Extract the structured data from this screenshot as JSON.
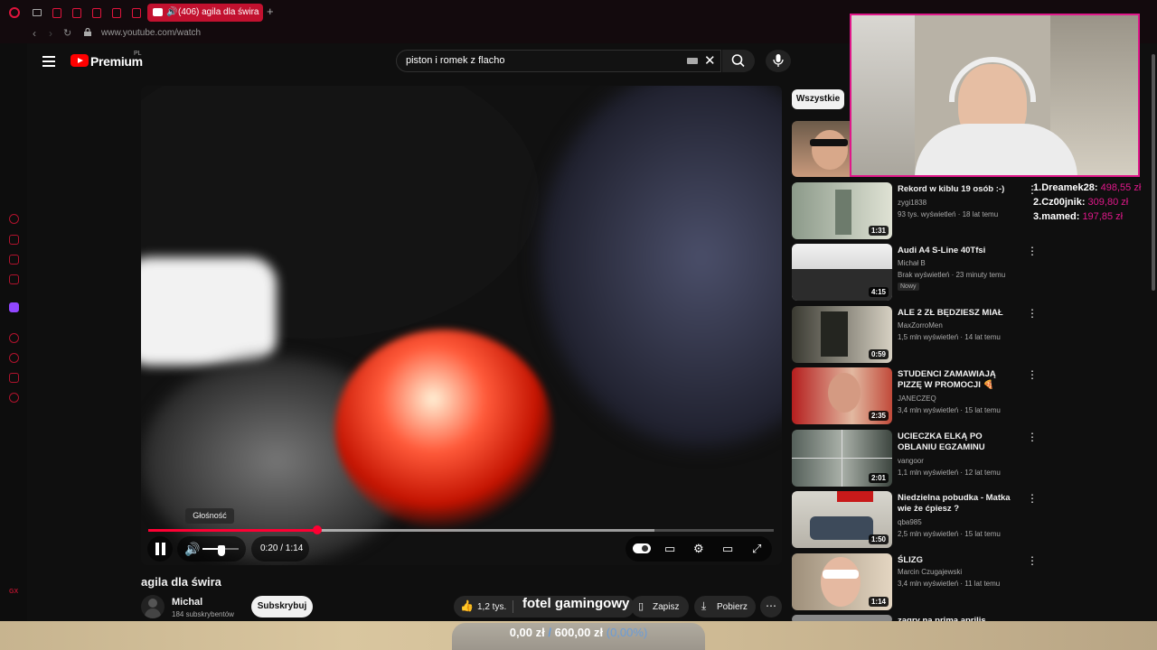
{
  "browser": {
    "tab_title": "(406) agila dla świra -",
    "url": "www.youtube.com/watch"
  },
  "youtube": {
    "brand": "Premium",
    "region": "PL",
    "search_query": "piston i romek z flacho"
  },
  "player": {
    "tooltip": "Głośność",
    "time": "0:20 / 1:14",
    "progress_fraction": 0.27,
    "volume_fraction": 0.5
  },
  "video": {
    "title": "agila dla świra",
    "channel": "Michal",
    "subscribers": "184 subskrybentów",
    "subscribe_label": "Subskrybuj",
    "likes": "1,2 tys.",
    "save_label": "Zapisz",
    "download_label": "Pobierz"
  },
  "filter_chip": "Wszystkie",
  "recommendations": [
    {
      "title": "Rekord w kiblu 19 osób :-)",
      "channel": "zygi1838",
      "meta": "93 tys. wyświetleń · 18 lat temu",
      "duration": "1:31"
    },
    {
      "title": "Audi A4 S-Line 40Tfsi",
      "channel": "Michał B",
      "meta": "Brak wyświetleń · 23 minuty temu",
      "badge": "Nowy",
      "duration": "4:15"
    },
    {
      "title": "ALE 2 ZŁ BĘDZIESZ MIAŁ",
      "channel": "MaxZorroMen",
      "meta": "1,5 mln wyświetleń · 14 lat temu",
      "duration": "0:59"
    },
    {
      "title": "STUDENCI ZAMAWIAJĄ PIZZĘ W PROMOCJI 🍕",
      "channel": "JANECZEQ",
      "meta": "3,4 mln wyświetleń · 15 lat temu",
      "duration": "2:35"
    },
    {
      "title": "UCIECZKA ELKĄ PO OBLANIU EGZAMINU",
      "channel": "vangoor",
      "meta": "1,1 mln wyświetleń · 12 lat temu",
      "duration": "2:01"
    },
    {
      "title": "Niedzielna pobudka - Matka wie że ćpiesz ?",
      "channel": "qba985",
      "meta": "2,5 mln wyświetleń · 15 lat temu",
      "duration": "1:50"
    },
    {
      "title": "ŚLIZG",
      "channel": "Marcin Czugajewski",
      "meta": "3,4 mln wyświetleń · 11 lat temu",
      "duration": "1:14"
    },
    {
      "title": "zagry na prima aprilis",
      "channel": "",
      "meta": "",
      "duration": ""
    }
  ],
  "overlay": {
    "leaderboard": [
      {
        "rank": "1.",
        "name": "Dreamek28:",
        "amount": "498,55 zł"
      },
      {
        "rank": "2.",
        "name": "Cz00jnik:",
        "amount": "309,80 zł"
      },
      {
        "rank": "3.",
        "name": "mamed:",
        "amount": "197,85 zł"
      }
    ],
    "goal_name": "fotel gamingowy",
    "goal_current": "0,00 zł",
    "goal_separator": "/",
    "goal_target": "600,00 zł",
    "goal_percent": "(0,00%)",
    "goal_fraction": 0.0
  },
  "colors": {
    "accent": "#ff0033",
    "opera": "#e0143c",
    "overlay_pink": "#e0188a"
  }
}
